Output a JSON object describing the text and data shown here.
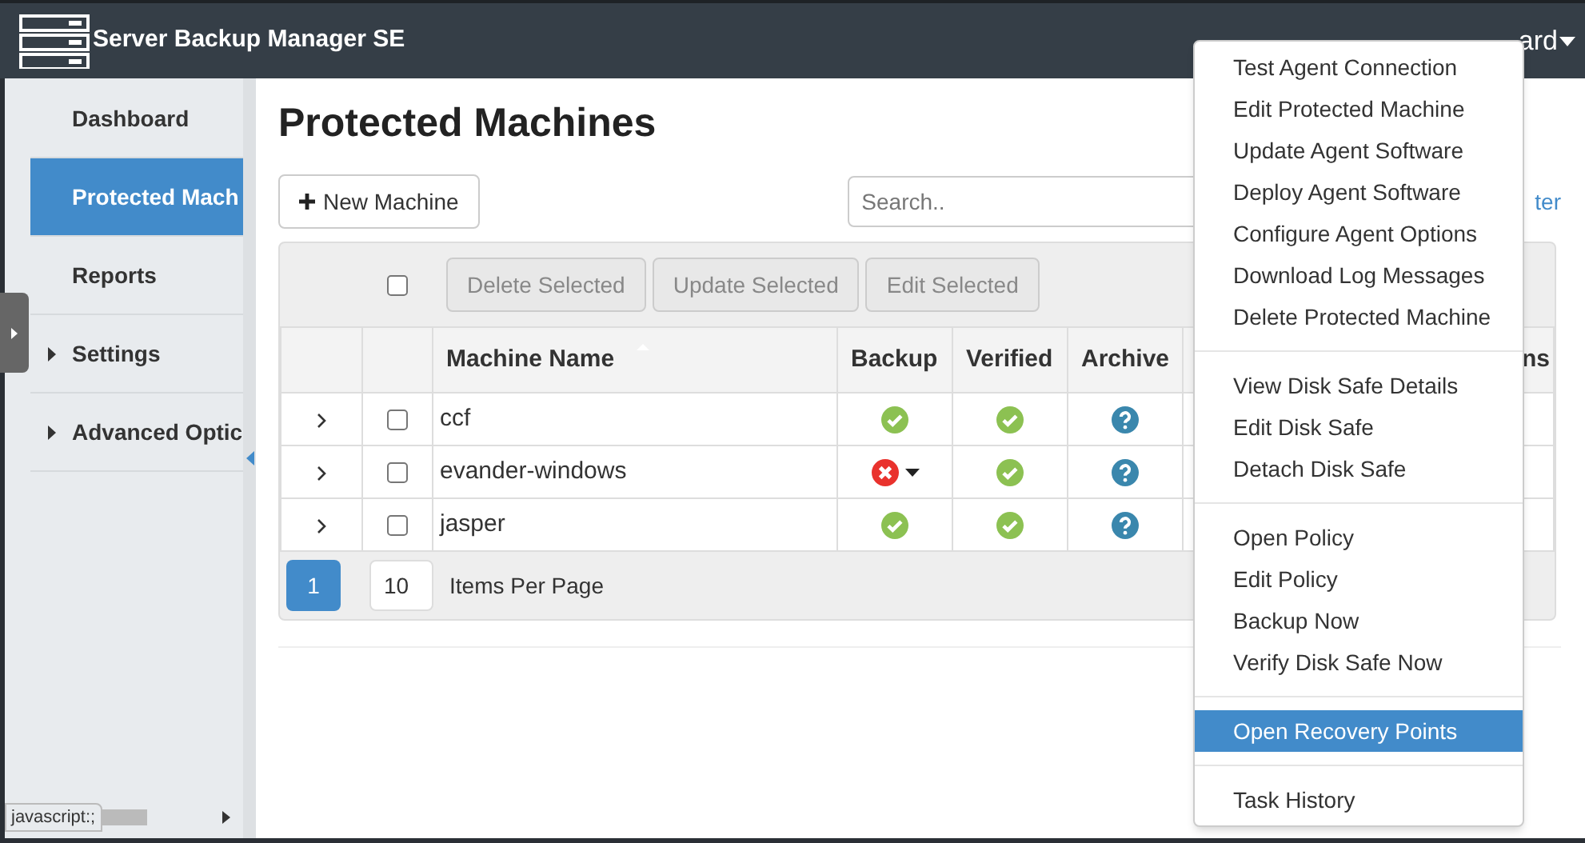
{
  "app": {
    "title": "Server Backup Manager SE",
    "user_fragment": "ard"
  },
  "sidebar": {
    "items": [
      {
        "label": "Dashboard",
        "selected": false,
        "expandable": false
      },
      {
        "label": "Protected Mach",
        "selected": true,
        "expandable": false
      },
      {
        "label": "Reports",
        "selected": false,
        "expandable": false
      },
      {
        "label": "Settings",
        "selected": false,
        "expandable": true
      },
      {
        "label": "Advanced Optic",
        "selected": false,
        "expandable": true
      }
    ]
  },
  "page": {
    "title": "Protected Machines",
    "new_button": "New Machine",
    "search": {
      "placeholder": "Search.."
    },
    "filter_link": "ter"
  },
  "table": {
    "toolbar": [
      {
        "label": "Delete Selected",
        "disabled": true
      },
      {
        "label": "Update Selected",
        "disabled": true
      },
      {
        "label": "Edit Selected",
        "disabled": true
      }
    ],
    "select_all": false,
    "columns": [
      "Machine Name",
      "Backup",
      "Verified",
      "Archive",
      "ns"
    ],
    "rows": [
      {
        "name": "ccf",
        "checked": false,
        "status": [
          {
            "kind": "ok"
          },
          {
            "kind": "ok"
          },
          {
            "kind": "unknown"
          }
        ]
      },
      {
        "name": "evander-windows",
        "checked": false,
        "status": [
          {
            "kind": "error"
          },
          {
            "kind": "ok"
          },
          {
            "kind": "unknown"
          }
        ]
      },
      {
        "name": "jasper",
        "checked": false,
        "status": [
          {
            "kind": "ok"
          },
          {
            "kind": "ok"
          },
          {
            "kind": "unknown"
          }
        ]
      }
    ],
    "pager": {
      "pages": [
        {
          "label": "1",
          "selected": true
        }
      ],
      "per_page": "10",
      "per_page_label": "Items Per Page"
    }
  },
  "menu": {
    "groups": [
      [
        {
          "label": "Test Agent Connection",
          "selected": false
        },
        {
          "label": "Edit Protected Machine",
          "selected": false
        },
        {
          "label": "Update Agent Software",
          "selected": false
        },
        {
          "label": "Deploy Agent Software",
          "selected": false
        },
        {
          "label": "Configure Agent Options",
          "selected": false
        },
        {
          "label": "Download Log Messages",
          "selected": false
        },
        {
          "label": "Delete Protected Machine",
          "selected": false
        }
      ],
      [
        {
          "label": "View Disk Safe Details",
          "selected": false
        },
        {
          "label": "Edit Disk Safe",
          "selected": false
        },
        {
          "label": "Detach Disk Safe",
          "selected": false
        }
      ],
      [
        {
          "label": "Open Policy",
          "selected": false
        },
        {
          "label": "Edit Policy",
          "selected": false
        },
        {
          "label": "Backup Now",
          "selected": false
        },
        {
          "label": "Verify Disk Safe Now",
          "selected": false
        }
      ],
      [
        {
          "label": "Open Recovery Points",
          "selected": true
        }
      ],
      [
        {
          "label": "Task History",
          "selected": false
        }
      ]
    ]
  },
  "status_bar": {
    "text": "javascript:;"
  }
}
